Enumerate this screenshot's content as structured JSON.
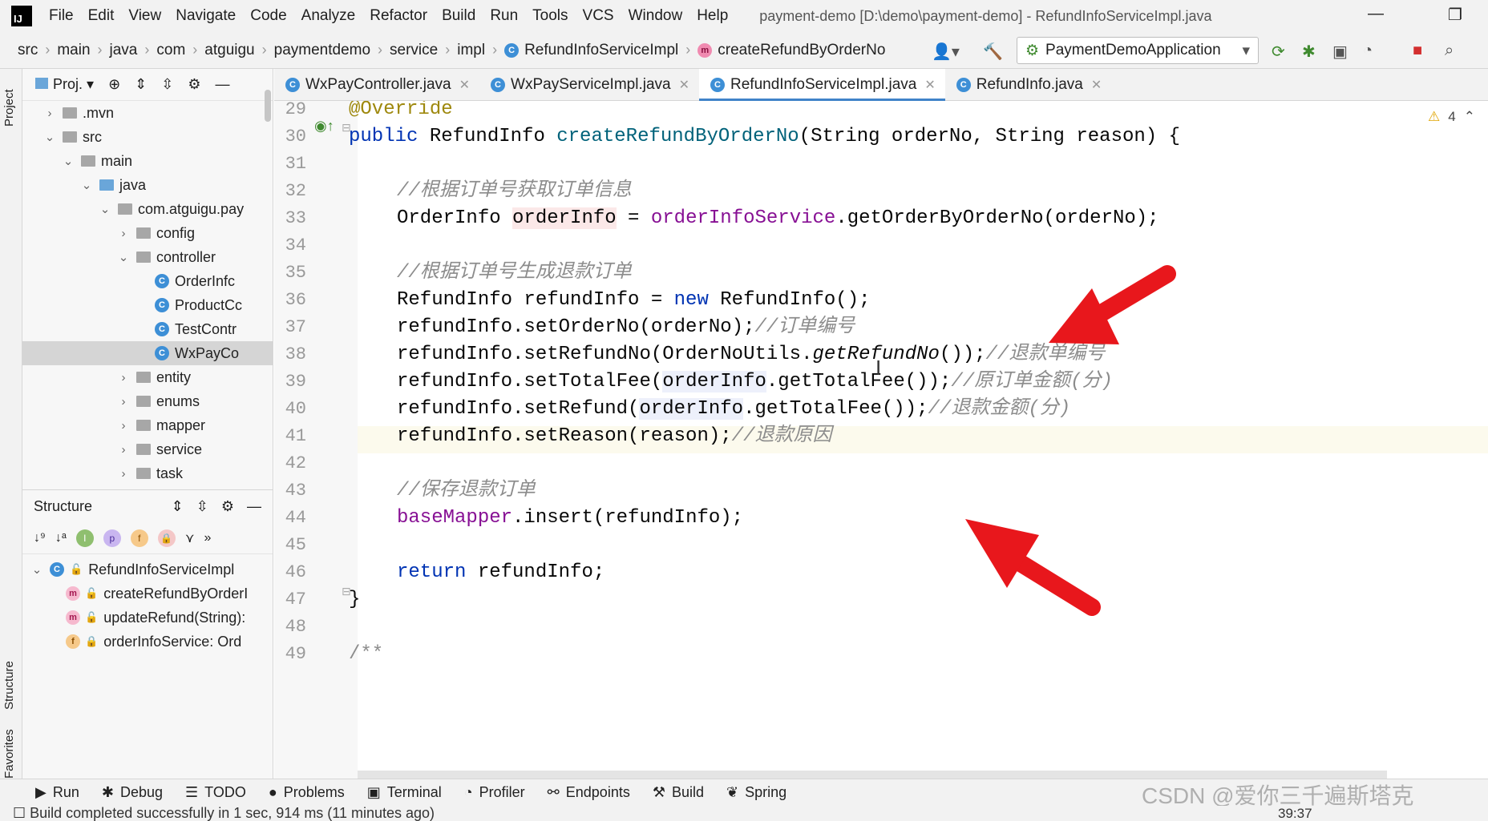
{
  "menubar": {
    "logo": "IJ",
    "items": [
      "File",
      "Edit",
      "View",
      "Navigate",
      "Code",
      "Analyze",
      "Refactor",
      "Build",
      "Run",
      "Tools",
      "VCS",
      "Window",
      "Help"
    ],
    "window_title": "payment-demo [D:\\demo\\payment-demo] - RefundInfoServiceImpl.java"
  },
  "navbar": {
    "crumbs": [
      "src",
      "main",
      "java",
      "com",
      "atguigu",
      "paymentdemo",
      "service",
      "impl"
    ],
    "class_crumb": "RefundInfoServiceImpl",
    "method_crumb": "createRefundByOrderNo",
    "run_config": "PaymentDemoApplication"
  },
  "left_strip": {
    "project_tab": "Project",
    "structure_tab": "Structure",
    "favorites_tab": "Favorites"
  },
  "project": {
    "header": "Proj.",
    "tree": [
      {
        "label": ".mvn",
        "depth": 0,
        "expanded": false,
        "type": "folder"
      },
      {
        "label": "src",
        "depth": 0,
        "expanded": true,
        "type": "folder"
      },
      {
        "label": "main",
        "depth": 1,
        "expanded": true,
        "type": "folder"
      },
      {
        "label": "java",
        "depth": 2,
        "expanded": true,
        "type": "folder-blue"
      },
      {
        "label": "com.atguigu.pay",
        "depth": 3,
        "expanded": true,
        "type": "package"
      },
      {
        "label": "config",
        "depth": 4,
        "expanded": false,
        "type": "package"
      },
      {
        "label": "controller",
        "depth": 4,
        "expanded": true,
        "type": "package"
      },
      {
        "label": "OrderInfc",
        "depth": 5,
        "type": "class"
      },
      {
        "label": "ProductCc",
        "depth": 5,
        "type": "class"
      },
      {
        "label": "TestContr",
        "depth": 5,
        "type": "class"
      },
      {
        "label": "WxPayCo",
        "depth": 5,
        "type": "class",
        "selected": true
      },
      {
        "label": "entity",
        "depth": 4,
        "expanded": false,
        "type": "package"
      },
      {
        "label": "enums",
        "depth": 4,
        "expanded": false,
        "type": "package"
      },
      {
        "label": "mapper",
        "depth": 4,
        "expanded": false,
        "type": "package"
      },
      {
        "label": "service",
        "depth": 4,
        "expanded": false,
        "type": "package"
      },
      {
        "label": "task",
        "depth": 4,
        "expanded": false,
        "type": "package"
      }
    ]
  },
  "structure": {
    "header": "Structure",
    "root": "RefundInfoServiceImpl",
    "members": [
      {
        "badge": "m",
        "label": "createRefundByOrderI"
      },
      {
        "badge": "m",
        "label": "updateRefund(String):"
      },
      {
        "badge": "f",
        "label": "orderInfoService: Ord"
      }
    ]
  },
  "tabs": [
    {
      "label": "WxPayController.java",
      "active": false
    },
    {
      "label": "WxPayServiceImpl.java",
      "active": false
    },
    {
      "label": "RefundInfoServiceImpl.java",
      "active": true
    },
    {
      "label": "RefundInfo.java",
      "active": false
    }
  ],
  "editor": {
    "warning_count": "4",
    "current_line": 39,
    "line_numbers": [
      "29",
      "30",
      "31",
      "32",
      "33",
      "34",
      "35",
      "36",
      "37",
      "38",
      "39",
      "40",
      "41",
      "42",
      "43",
      "44",
      "45",
      "46",
      "47",
      "48",
      "49"
    ],
    "lines": {
      "l29": "@Override",
      "l30_kw": "public",
      "l30_type": " RefundInfo ",
      "l30_fn": "createRefundByOrderNo",
      "l30_rest": "(String orderNo, String reason) {",
      "l32": "//根据订单号获取订单信息",
      "l33_a": "OrderInfo ",
      "l33_var": "orderInfo",
      "l33_b": " = ",
      "l33_fld": "orderInfoService",
      "l33_c": ".getOrderByOrderNo(orderNo);",
      "l35": "//根据订单号生成退款订单",
      "l36_a": "RefundInfo refundInfo = ",
      "l36_kw": "new",
      "l36_b": " RefundInfo();",
      "l37_code": "refundInfo.setOrderNo(orderNo);",
      "l37_cm": "//订单编号",
      "l38_a": "refundInfo.setRefundNo(OrderNoUtils.",
      "l38_it": "getRefundNo",
      "l38_b": "());",
      "l38_cm": "//退款单编号",
      "l39_a": "refundInfo.setTotalFee(",
      "l39_ref": "orderInfo",
      "l39_b": ".getTotalFee());",
      "l39_cm": "//原订单金额(分)",
      "l40_a": "refundInfo.setRefund(",
      "l40_ref": "orderInfo",
      "l40_b": ".getTotalFee());",
      "l40_cm": "//退款金额(分)",
      "l41_code": "refundInfo.setReason(reason);",
      "l41_cm": "//退款原因",
      "l43": "//保存退款订单",
      "l44_fld": "baseMapper",
      "l44_b": ".insert(refundInfo);",
      "l46_kw": "return",
      "l46_b": " refundInfo;",
      "l47": "}",
      "l49": "/**"
    }
  },
  "bottom_tools": [
    "Run",
    "Debug",
    "TODO",
    "Problems",
    "Terminal",
    "Profiler",
    "Endpoints",
    "Build",
    "Spring"
  ],
  "status": {
    "message": "Build completed successfully in 1 sec, 914 ms (11 minutes ago)",
    "cursor": "39:37"
  },
  "watermark": "CSDN @爱你三千遍斯塔克",
  "colors": {
    "accent": "#4083c9",
    "arrow": "#e8171c"
  }
}
